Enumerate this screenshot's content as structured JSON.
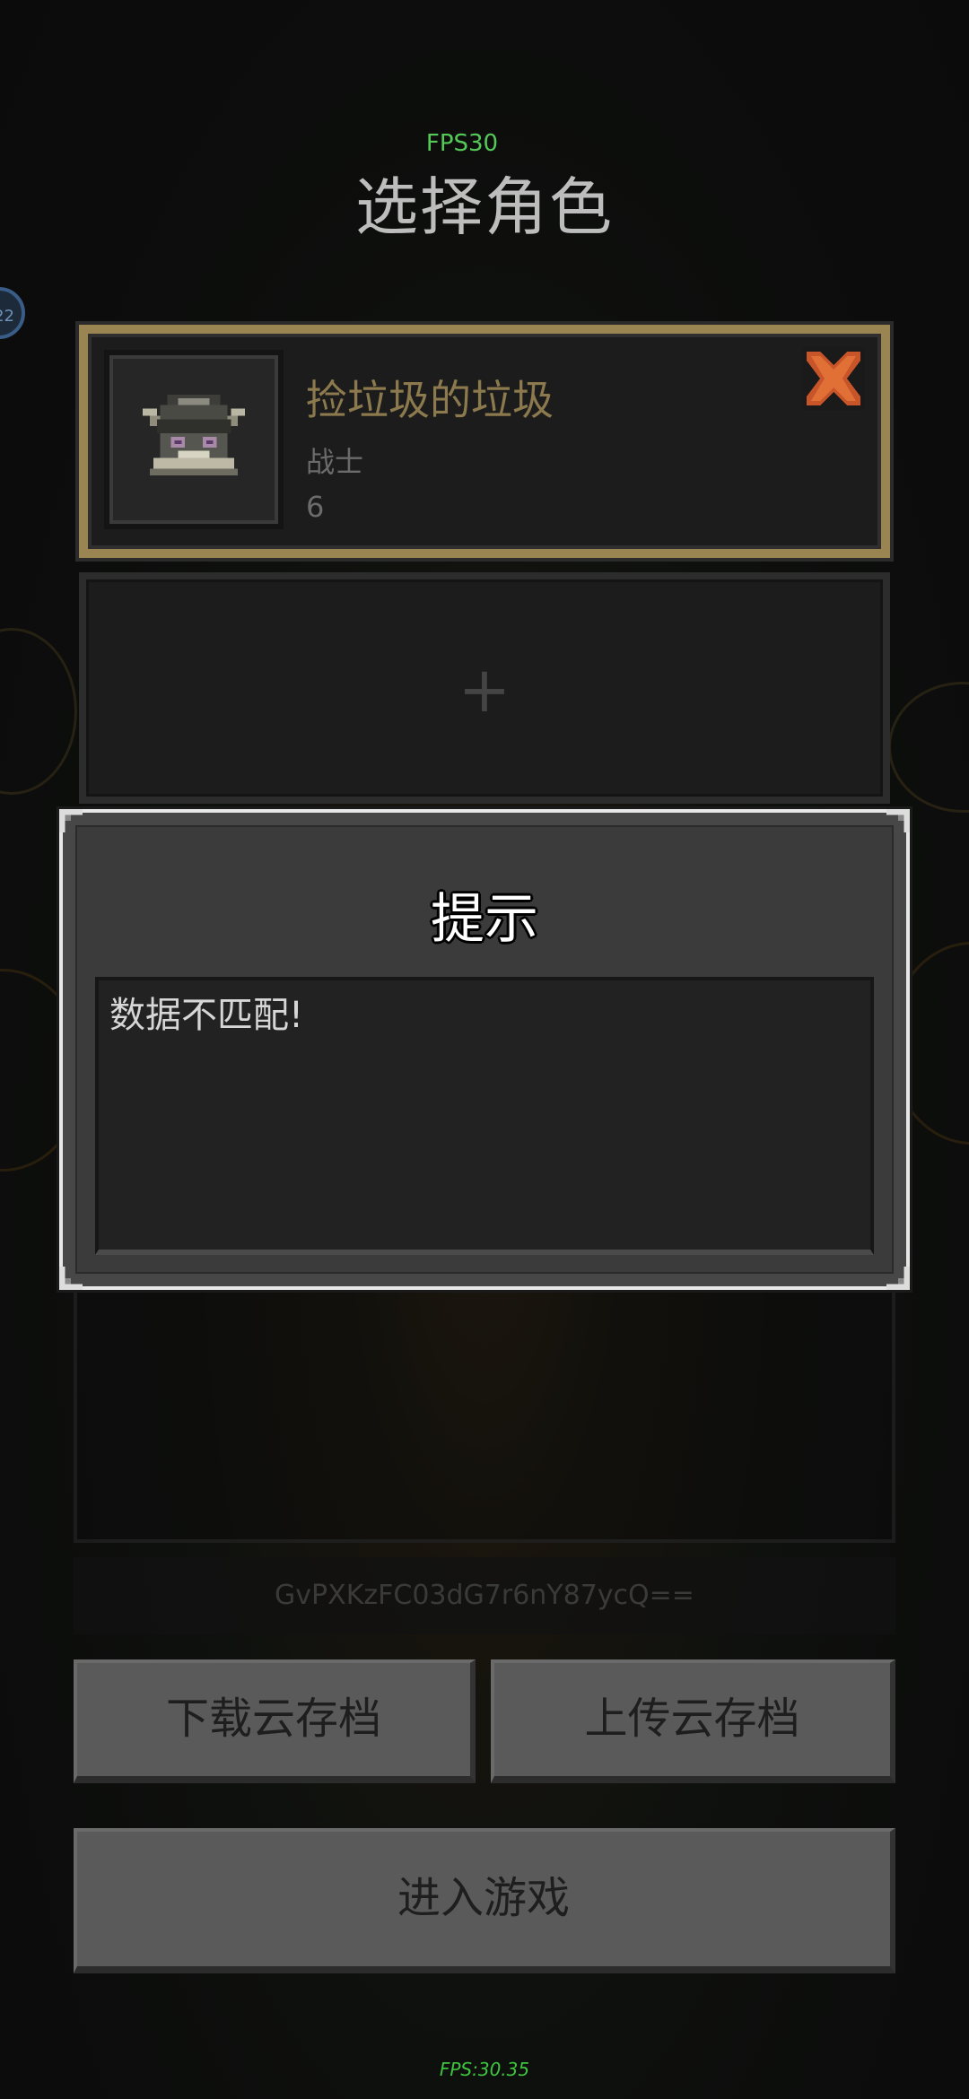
{
  "status": {
    "fps_top": "FPS30",
    "fps_bottom": "FPS:30.35",
    "level_badge": "22"
  },
  "header": {
    "title": "选择角色"
  },
  "slots": [
    {
      "name": "捡垃圾的垃圾",
      "class": "战士",
      "level": "6",
      "icon": "helmet-icon"
    },
    {
      "empty": true,
      "icon": "plus-icon",
      "label": "+"
    }
  ],
  "token": "GvPXKzFC03dG7r6nY87ycQ==",
  "buttons": {
    "download": "下载云存档",
    "upload": "上传云存档",
    "enter": "进入游戏"
  },
  "dialog": {
    "title": "提示",
    "message": "数据不匹配!"
  },
  "colors": {
    "selected_border": "#9a8452",
    "name_text": "#8c7a4e",
    "delete_icon": "#c8552a",
    "fps": "#55c957"
  }
}
